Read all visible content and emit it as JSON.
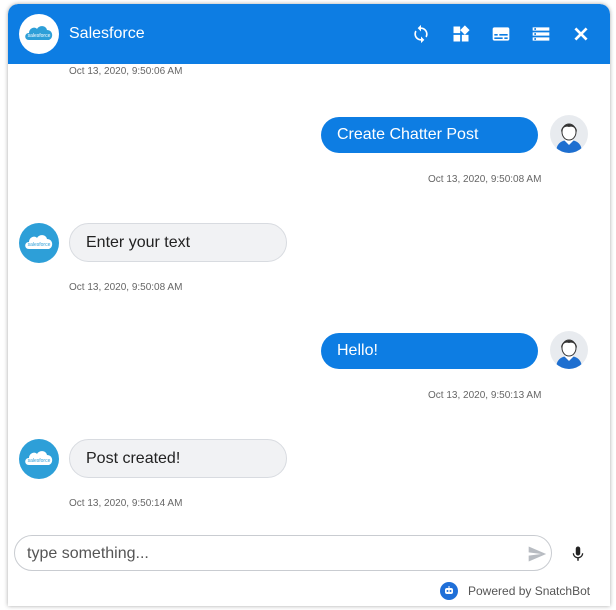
{
  "header": {
    "title": "Salesforce",
    "logo_text": "salesforce",
    "icons": [
      "refresh-icon",
      "widgets-icon",
      "subtitles-icon",
      "storage-icon",
      "close-icon"
    ],
    "color": "#0d7de3"
  },
  "messages": [
    {
      "from": "bot",
      "timestamp": "Oct 13, 2020, 9:50:06 AM"
    },
    {
      "from": "user",
      "text": "Create Chatter Post",
      "timestamp": "Oct 13, 2020, 9:50:08 AM"
    },
    {
      "from": "bot",
      "text": "Enter your text",
      "timestamp": "Oct 13, 2020, 9:50:08 AM"
    },
    {
      "from": "user",
      "text": "Hello!",
      "timestamp": "Oct 13, 2020, 9:50:13 AM"
    },
    {
      "from": "bot",
      "text": "Post created!",
      "timestamp": "Oct 13, 2020, 9:50:14 AM"
    }
  ],
  "composer": {
    "placeholder": "type something...",
    "value": ""
  },
  "footer": {
    "powered_by": "Powered by SnatchBot"
  }
}
